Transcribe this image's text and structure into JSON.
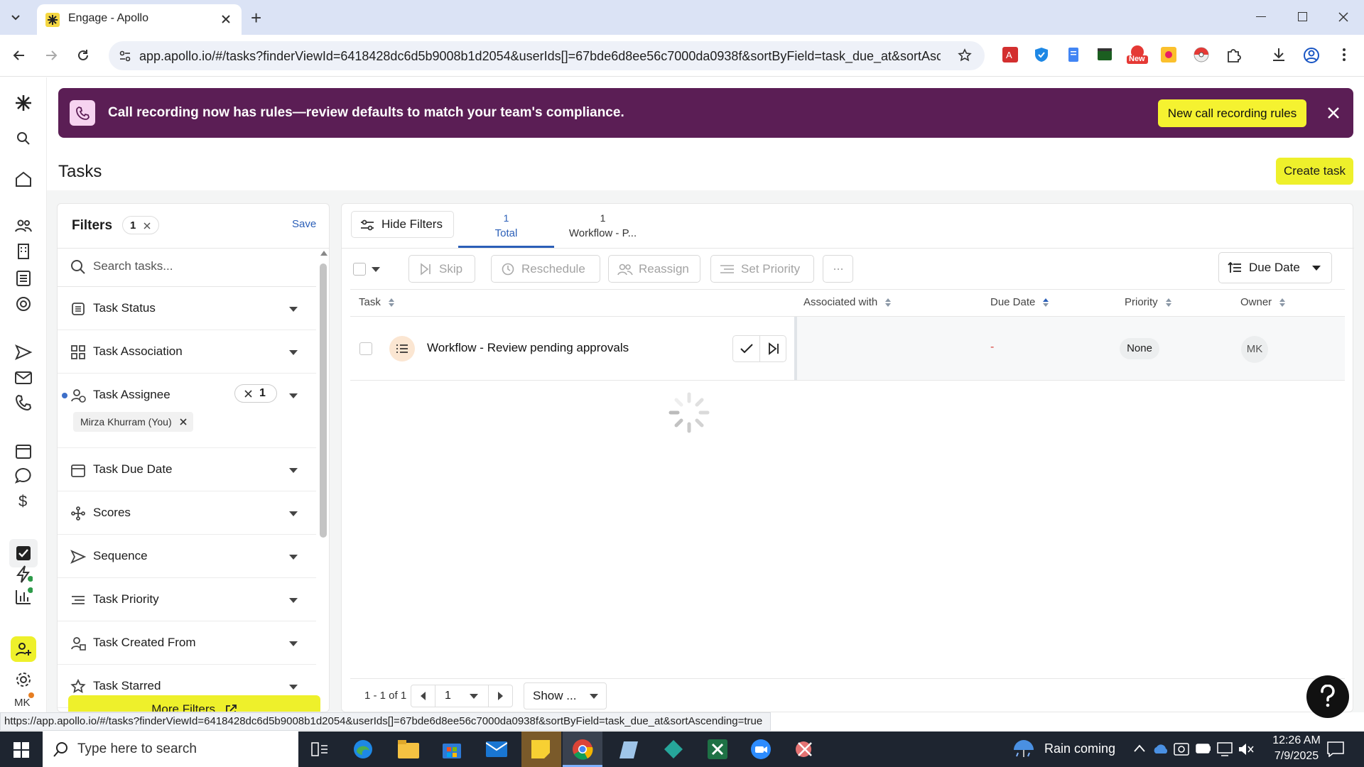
{
  "browser": {
    "tab_title": "Engage - Apollo",
    "new_tab": "+",
    "url": "app.apollo.io/#/tasks?finderViewId=6418428dc6d5b9008b1d2054&userIds[]=67bde6d8ee56c7000da0938f&sortByField=task_due_at&sortAscen...",
    "ext_badge": "New",
    "status_url": "https://app.apollo.io/#/tasks?finderViewId=6418428dc6d5b9008b1d2054&userIds[]=67bde6d8ee56c7000da0938f&sortByField=task_due_at&sortAscending=true"
  },
  "banner": {
    "text": "Call recording now has rules—review defaults to match your team's compliance.",
    "button": "New call recording rules",
    "bg": "#5b1e55",
    "accent": "#f5f230"
  },
  "page": {
    "title": "Tasks",
    "create_button": "Create task",
    "user_initials": "MK"
  },
  "filters": {
    "heading": "Filters",
    "count": "1",
    "save": "Save",
    "search_placeholder": "Search tasks...",
    "assignee_count": "1",
    "assignee_chip": "Mirza Khurram (You)",
    "items": [
      {
        "label": "Task Status",
        "icon": "task-status-icon"
      },
      {
        "label": "Task Association",
        "icon": "grid-icon"
      },
      {
        "label": "Task Assignee",
        "icon": "assignee-icon"
      },
      {
        "label": "Task Due Date",
        "icon": "calendar-icon"
      },
      {
        "label": "Scores",
        "icon": "scores-icon"
      },
      {
        "label": "Sequence",
        "icon": "send-icon"
      },
      {
        "label": "Task Priority",
        "icon": "priority-icon"
      },
      {
        "label": "Task Created From",
        "icon": "created-from-icon"
      },
      {
        "label": "Task Starred",
        "icon": "star-icon"
      }
    ],
    "more_filters": "More Filters"
  },
  "main": {
    "hide_filters": "Hide Filters",
    "tabs": [
      {
        "count": "1",
        "label": "Total"
      },
      {
        "count": "1",
        "label": "Workflow - P..."
      }
    ],
    "actions": {
      "skip": "Skip",
      "reschedule": "Reschedule",
      "reassign": "Reassign",
      "set_priority": "Set Priority",
      "more": "···"
    },
    "sort": "Due Date",
    "columns": {
      "task": "Task",
      "associated": "Associated with",
      "due": "Due Date",
      "priority": "Priority",
      "owner": "Owner"
    },
    "rows": [
      {
        "task": "Workflow - Review pending approvals",
        "associated": "",
        "due": "-",
        "priority": "None",
        "owner": "MK"
      }
    ],
    "pagination": {
      "range": "1 - 1 of 1",
      "page": "1",
      "show": "Show ..."
    }
  },
  "taskbar": {
    "search_placeholder": "Type here to search",
    "weather": "Rain coming",
    "time": "12:26 AM",
    "date": "7/9/2025"
  }
}
